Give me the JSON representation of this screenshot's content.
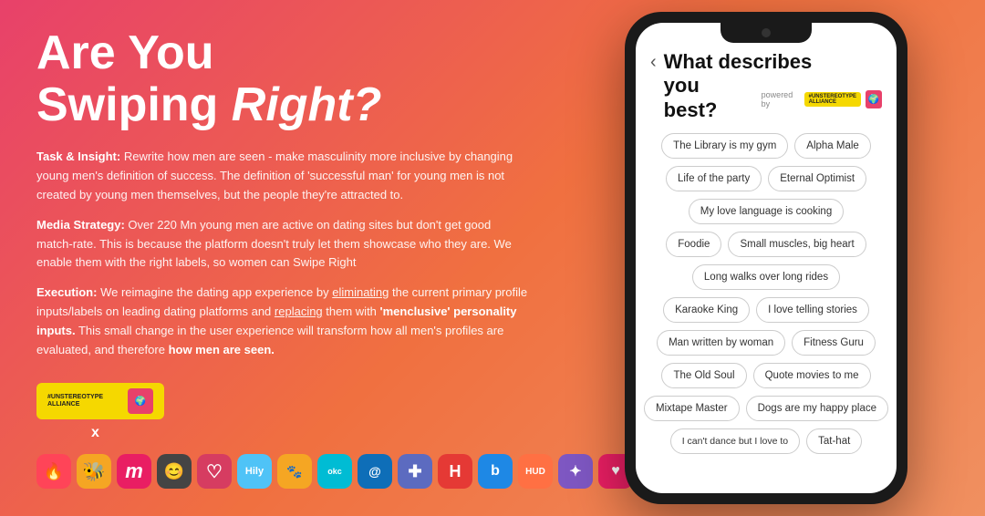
{
  "headline": {
    "line1": "Are You",
    "line2": "Swiping ",
    "line2_italic": "Right?"
  },
  "sections": [
    {
      "id": "task",
      "label": "Task & Insight:",
      "text": " Rewrite how men are seen - make masculinity more inclusive by changing young men's definition of success. The definition of 'successful man' for young men is not created by young men themselves, but the people they're attracted to."
    },
    {
      "id": "media",
      "label": "Media Strategy:",
      "text": " Over 220 Mn young men are active on dating sites but don't get good match-rate. This is because the platform doesn't truly let them showcase who they are. We enable them with the right labels, so women can Swipe Right"
    },
    {
      "id": "execution",
      "label": "Execution:",
      "text": " We reimagine the dating app experience by eliminating the current primary profile inputs/labels on leading dating platforms and replacing them with 'menclusive' personality inputs. This small change in the user experience will transform how all men's profiles are evaluated, and therefore how men are seen."
    }
  ],
  "logo": {
    "line1": "#UNSTEREOTYPE",
    "line2": "ALLIANCE"
  },
  "x_label": "x",
  "app_icons": [
    {
      "name": "tinder",
      "label": "🔥",
      "class": "icon-tinder"
    },
    {
      "name": "bumble",
      "label": "🐝",
      "class": "icon-bumble"
    },
    {
      "name": "meetic",
      "label": "m",
      "class": "icon-meetic"
    },
    {
      "name": "happn",
      "label": "😊",
      "class": "icon-happn"
    },
    {
      "name": "hinge",
      "label": "◇",
      "class": "icon-hinge"
    },
    {
      "name": "hily",
      "label": "Hily",
      "class": "icon-hily"
    },
    {
      "name": "grindr",
      "label": "🟡",
      "class": "icon-grindr"
    },
    {
      "name": "pof",
      "label": "~",
      "class": "icon-plenty"
    },
    {
      "name": "okc",
      "label": "okc",
      "class": "icon-okc"
    },
    {
      "name": "tagged",
      "label": "✚",
      "class": "icon-tagged"
    },
    {
      "name": "hitch",
      "label": "H",
      "class": "icon-hitch"
    },
    {
      "name": "badoo",
      "label": "b",
      "class": "icon-badoo"
    },
    {
      "name": "hud",
      "label": "HUD",
      "class": "icon-hud"
    },
    {
      "name": "unknown",
      "label": "✦",
      "class": "icon-unknown"
    },
    {
      "name": "chispa",
      "label": "♥",
      "class": "icon-chispa"
    }
  ],
  "phone": {
    "back_icon": "‹",
    "title_line1": "What describes",
    "title_line2": "you best?",
    "powered_by": "powered by",
    "badge_line1": "#UNSTEREOTYPE",
    "badge_line2": "ALLIANCE",
    "tag_rows": [
      [
        "The Library is my gym",
        "Alpha Male"
      ],
      [
        "Life of the party",
        "Eternal Optimist"
      ],
      [
        "My love language is cooking"
      ],
      [
        "Foodie",
        "Small muscles, big heart"
      ],
      [
        "Long walks over long rides"
      ],
      [
        "Karaoke King",
        "I love telling stories"
      ],
      [
        "Man written by woman",
        "Fitness Guru"
      ],
      [
        "The Old Soul",
        "Quote movies to me"
      ],
      [
        "Mixtape Master",
        "Dogs are my happy place"
      ],
      [
        "I can't dance but I love to",
        "Tat-hat"
      ]
    ]
  }
}
